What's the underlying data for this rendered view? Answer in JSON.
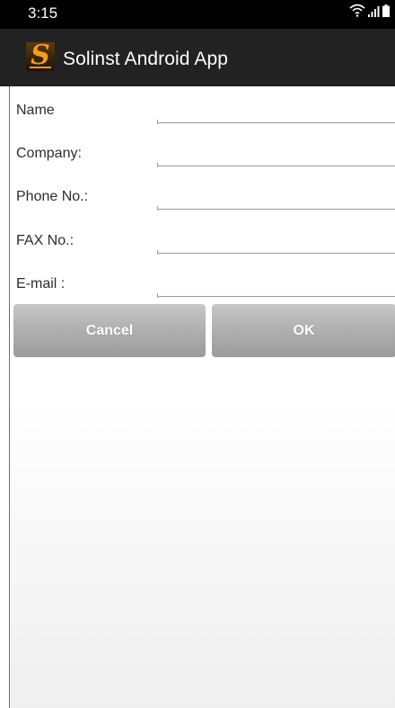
{
  "status_bar": {
    "time": "3:15",
    "icons": [
      "wifi-icon",
      "signal-icon",
      "battery-icon"
    ]
  },
  "app_bar": {
    "logo_letter": "S",
    "title": "Solinst Android App",
    "logo_color": "#f59a1b",
    "background": "#222222"
  },
  "form": {
    "fields": [
      {
        "label": "Name",
        "value": ""
      },
      {
        "label": "Company:",
        "value": ""
      },
      {
        "label": "Phone No.:",
        "value": ""
      },
      {
        "label": "FAX No.:",
        "value": ""
      },
      {
        "label": "E-mail :",
        "value": ""
      }
    ]
  },
  "buttons": {
    "cancel_label": "Cancel",
    "ok_label": "OK"
  }
}
